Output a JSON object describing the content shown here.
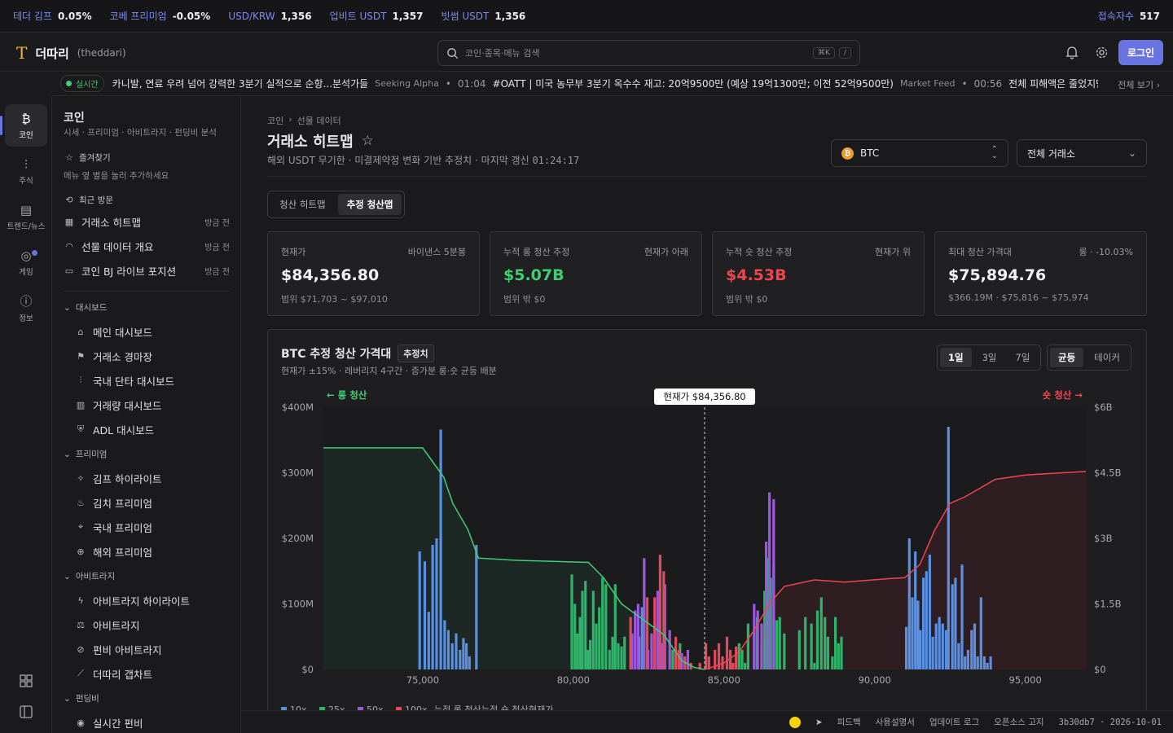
{
  "ticker": [
    {
      "label": "테더 김프",
      "value": "0.05%"
    },
    {
      "label": "코베 프리미엄",
      "value": "-0.05%"
    },
    {
      "label": "USD/KRW",
      "value": "1,356"
    },
    {
      "label": "업비트 USDT",
      "value": "1,357"
    },
    {
      "label": "빗썸 USDT",
      "value": "1,356"
    }
  ],
  "visitors": {
    "label": "접속자수",
    "value": "517"
  },
  "brand": {
    "logo": "T",
    "name": "더따리",
    "sub": "(theddari)"
  },
  "search": {
    "placeholder": "코인·종목·메뉴 검색",
    "kbd1": "⌘K",
    "kbd2": "/"
  },
  "login_label": "로그인",
  "newsbar": {
    "live": "실시간",
    "items": [
      {
        "time": "",
        "text": "카니발, 연료 우려 넘어 강력한 3분기 실적으로 순항...분석가들",
        "source": "Seeking Alpha"
      },
      {
        "time": "01:04",
        "text": "#OATT | 미국 농무부 3분기 옥수수 재고: 20억9500만 (예상 19억1300만; 이전 52억9500만)",
        "source": "Market Feed"
      },
      {
        "time": "00:56",
        "text": "전체 피해액은 줄었지만 해",
        "source": ""
      }
    ],
    "more": "전체 보기 ›"
  },
  "rail": [
    {
      "label": "코인",
      "icon": "bitcoin-icon",
      "glyph": "₿"
    },
    {
      "label": "주식",
      "icon": "stock-icon",
      "glyph": "⫶"
    },
    {
      "label": "트렌드/뉴스",
      "icon": "news-icon",
      "glyph": "▤"
    },
    {
      "label": "게임",
      "icon": "gamepad-icon",
      "glyph": "◎"
    },
    {
      "label": "정보",
      "icon": "info-icon",
      "glyph": "ⓘ"
    }
  ],
  "nav": {
    "title": "코인",
    "subtitle": "시세 · 프리미엄 · 아비트라지 · 펀딩비 분석",
    "favorites": "즐겨찾기",
    "favorites_hint": "메뉴 옆 별을 눌러 추가하세요",
    "recent": "최근 방문",
    "recent_items": [
      {
        "label": "거래소 히트맵",
        "time": "방금 전"
      },
      {
        "label": "선물 데이터 개요",
        "time": "방금 전"
      },
      {
        "label": "코인 BJ 라이브 포지션",
        "time": "방금 전"
      }
    ],
    "groups": [
      {
        "label": "대시보드",
        "items": [
          "메인 대시보드",
          "거래소 경마장",
          "국내 단타 대시보드",
          "거래량 대시보드",
          "ADL 대시보드"
        ]
      },
      {
        "label": "프리미엄",
        "items": [
          "김프 하이라이트",
          "김치 프리미엄",
          "국내 프리미엄",
          "해외 프리미엄"
        ]
      },
      {
        "label": "아비트라지",
        "items": [
          "아비트라지 하이라이트",
          "아비트라지",
          "펀비 아비트라지",
          "더따리 갭차트"
        ]
      },
      {
        "label": "펀딩비",
        "items": [
          "실시간 펀비"
        ]
      }
    ]
  },
  "page": {
    "crumb1": "코인",
    "crumb2": "선물 데이터",
    "title": "거래소 히트맵",
    "subtitle": "해외 USDT 무기한 · 미결제약정 변화 기반 추정치 · 마지막 갱신 ",
    "updated": "01:24:17",
    "asset": "BTC",
    "exchange": "전체 거래소",
    "tabs": [
      "청산 히트맵",
      "추정 청산맵"
    ]
  },
  "cards": [
    {
      "label": "현재가",
      "right": "바이낸스 5분봉",
      "value": "$84,356.80",
      "sub": "범위 $71,703 ~ $97,010",
      "tone": ""
    },
    {
      "label": "누적 롱 청산 추정",
      "right": "현재가 아래",
      "value": "$5.07B",
      "sub": "범위 밖 $0",
      "tone": "g"
    },
    {
      "label": "누적 숏 청산 추정",
      "right": "현재가 위",
      "value": "$4.53B",
      "sub": "범위 밖 $0",
      "tone": "r"
    },
    {
      "label": "최대 청산 가격대",
      "right": "롱 · -10.03%",
      "value": "$75,894.76",
      "sub": "$366.19M · $75,816 ~ $75,974",
      "tone": ""
    }
  ],
  "chart_panel": {
    "title": "BTC 추정 청산 가격대",
    "badge": "추정치",
    "subtitle": "현재가 ±15% · 레버리지 4구간 · 증가분 롱·숏 균등 배분",
    "ranges": [
      "1일",
      "3일",
      "7일"
    ],
    "modes": [
      "균등",
      "테이커"
    ],
    "long_label": "← 롱 청산",
    "short_label": "숏 청산 →",
    "price_tag": "현재가 $84,356.80"
  },
  "colors": {
    "lev10": "#5b8fe0",
    "lev25": "#2fb36a",
    "lev50": "#9b57e0",
    "lev100": "#e04a5a",
    "long_line": "#3ecf75",
    "short_line": "#f0454f",
    "accent": "#6a74e0"
  },
  "chart_data": {
    "type": "bar",
    "x_range": [
      71703,
      97010
    ],
    "current_price": 84356.8,
    "x_ticks": [
      "75,000",
      "80,000",
      "85,000",
      "90,000",
      "95,000"
    ],
    "x_tick_values": [
      75000,
      80000,
      85000,
      90000,
      95000
    ],
    "y_left": {
      "ticks": [
        "$0",
        "$100M",
        "$200M",
        "$300M",
        "$400M"
      ],
      "range": [
        0,
        400
      ]
    },
    "y_right": {
      "ticks": [
        "$0",
        "$1.5B",
        "$3B",
        "$4.5B",
        "$6B"
      ],
      "range": [
        0,
        6
      ]
    },
    "legend": [
      "10x",
      "25x",
      "50x",
      "100x",
      "누적 롱 청산",
      "누적 숏 청산",
      "현재가"
    ],
    "series": [
      {
        "name": "10x",
        "bars": [
          [
            74900,
            180
          ],
          [
            75070,
            165
          ],
          [
            75200,
            88
          ],
          [
            75330,
            190
          ],
          [
            75460,
            200
          ],
          [
            75600,
            366
          ],
          [
            75730,
            75
          ],
          [
            75850,
            60
          ],
          [
            75980,
            40
          ],
          [
            76110,
            55
          ],
          [
            76240,
            30
          ],
          [
            76350,
            48
          ],
          [
            76450,
            40
          ],
          [
            76550,
            20
          ],
          [
            76780,
            190
          ],
          [
            82180,
            50
          ],
          [
            82280,
            95
          ],
          [
            91050,
            65
          ],
          [
            91150,
            200
          ],
          [
            91250,
            110
          ],
          [
            91350,
            180
          ],
          [
            91440,
            105
          ],
          [
            91520,
            60
          ],
          [
            91620,
            140
          ],
          [
            91720,
            150
          ],
          [
            91830,
            175
          ],
          [
            91930,
            50
          ],
          [
            92040,
            70
          ],
          [
            92150,
            80
          ],
          [
            92260,
            70
          ],
          [
            92370,
            60
          ],
          [
            92450,
            370
          ],
          [
            92580,
            130
          ],
          [
            92680,
            140
          ],
          [
            92790,
            40
          ],
          [
            92900,
            160
          ],
          [
            93000,
            20
          ],
          [
            93100,
            30
          ],
          [
            93220,
            60
          ],
          [
            93320,
            70
          ],
          [
            93420,
            20
          ],
          [
            93530,
            110
          ],
          [
            93640,
            20
          ],
          [
            93740,
            10
          ],
          [
            93850,
            20
          ]
        ]
      },
      {
        "name": "25x",
        "bars": [
          [
            79950,
            145
          ],
          [
            80050,
            100
          ],
          [
            80130,
            55
          ],
          [
            80220,
            80
          ],
          [
            80300,
            120
          ],
          [
            80400,
            135
          ],
          [
            80480,
            30
          ],
          [
            80560,
            45
          ],
          [
            80660,
            120
          ],
          [
            80760,
            70
          ],
          [
            80860,
            95
          ],
          [
            80970,
            140
          ],
          [
            81080,
            130
          ],
          [
            81200,
            30
          ],
          [
            81300,
            50
          ],
          [
            81390,
            130
          ],
          [
            81490,
            40
          ],
          [
            81600,
            35
          ],
          [
            81700,
            50
          ],
          [
            83300,
            30
          ],
          [
            83400,
            20
          ],
          [
            83540,
            40
          ],
          [
            85500,
            40
          ],
          [
            85600,
            30
          ],
          [
            85700,
            10
          ],
          [
            85800,
            70
          ],
          [
            86000,
            60
          ],
          [
            86100,
            80
          ],
          [
            86250,
            40
          ],
          [
            86350,
            120
          ],
          [
            86450,
            170
          ],
          [
            86550,
            140
          ],
          [
            86650,
            160
          ],
          [
            86750,
            75
          ],
          [
            86850,
            80
          ],
          [
            87000,
            55
          ],
          [
            87500,
            60
          ],
          [
            87700,
            80
          ],
          [
            87900,
            70
          ],
          [
            88000,
            10
          ],
          [
            88100,
            90
          ],
          [
            88230,
            110
          ],
          [
            88350,
            80
          ],
          [
            88450,
            50
          ],
          [
            88600,
            20
          ],
          [
            88700,
            80
          ],
          [
            88800,
            40
          ],
          [
            88900,
            50
          ]
        ]
      },
      {
        "name": "50x",
        "bars": [
          [
            81950,
            55
          ],
          [
            82050,
            90
          ],
          [
            82150,
            100
          ],
          [
            82350,
            170
          ],
          [
            82480,
            30
          ],
          [
            82600,
            55
          ],
          [
            82700,
            70
          ],
          [
            82800,
            120
          ],
          [
            82960,
            40
          ],
          [
            83040,
            130
          ],
          [
            83200,
            60
          ],
          [
            83600,
            25
          ],
          [
            83800,
            30
          ],
          [
            86000,
            100
          ],
          [
            86120,
            90
          ],
          [
            86250,
            70
          ],
          [
            86400,
            195
          ],
          [
            86510,
            270
          ],
          [
            86650,
            260
          ]
        ]
      },
      {
        "name": "100x",
        "bars": [
          [
            81900,
            80
          ],
          [
            82450,
            110
          ],
          [
            82700,
            110
          ],
          [
            82880,
            175
          ],
          [
            83000,
            150
          ],
          [
            83400,
            50
          ],
          [
            83500,
            30
          ],
          [
            83700,
            20
          ],
          [
            83900,
            10
          ],
          [
            84200,
            10
          ],
          [
            84400,
            40
          ],
          [
            84500,
            20
          ],
          [
            84700,
            30
          ],
          [
            84830,
            40
          ],
          [
            84950,
            20
          ],
          [
            85100,
            50
          ],
          [
            85210,
            30
          ],
          [
            85300,
            10
          ],
          [
            85400,
            35
          ]
        ]
      }
    ],
    "cumulative_long": [
      [
        71703,
        5.07
      ],
      [
        75000,
        5.07
      ],
      [
        75700,
        4.4
      ],
      [
        76000,
        3.8
      ],
      [
        76500,
        3.2
      ],
      [
        76850,
        2.55
      ],
      [
        78000,
        2.5
      ],
      [
        80500,
        2.45
      ],
      [
        81000,
        2.1
      ],
      [
        81600,
        1.5
      ],
      [
        82400,
        1.1
      ],
      [
        83000,
        0.8
      ],
      [
        83600,
        0.2
      ],
      [
        84000,
        0.05
      ],
      [
        84356,
        0
      ]
    ],
    "cumulative_short": [
      [
        84356,
        0
      ],
      [
        84600,
        0.05
      ],
      [
        85000,
        0.15
      ],
      [
        85500,
        0.4
      ],
      [
        86000,
        0.9
      ],
      [
        86500,
        1.5
      ],
      [
        87000,
        1.9
      ],
      [
        88000,
        2.05
      ],
      [
        89000,
        2.0
      ],
      [
        90500,
        2.08
      ],
      [
        91000,
        2.1
      ],
      [
        91500,
        2.4
      ],
      [
        92000,
        3.2
      ],
      [
        92500,
        3.8
      ],
      [
        93000,
        3.95
      ],
      [
        94000,
        4.35
      ],
      [
        95000,
        4.45
      ],
      [
        97010,
        4.53
      ]
    ]
  },
  "footer": {
    "links": [
      "피드백",
      "사용설명서",
      "업데이트 로그",
      "오픈소스 고지"
    ],
    "version": "3b30db7 · 2026-10-01"
  }
}
